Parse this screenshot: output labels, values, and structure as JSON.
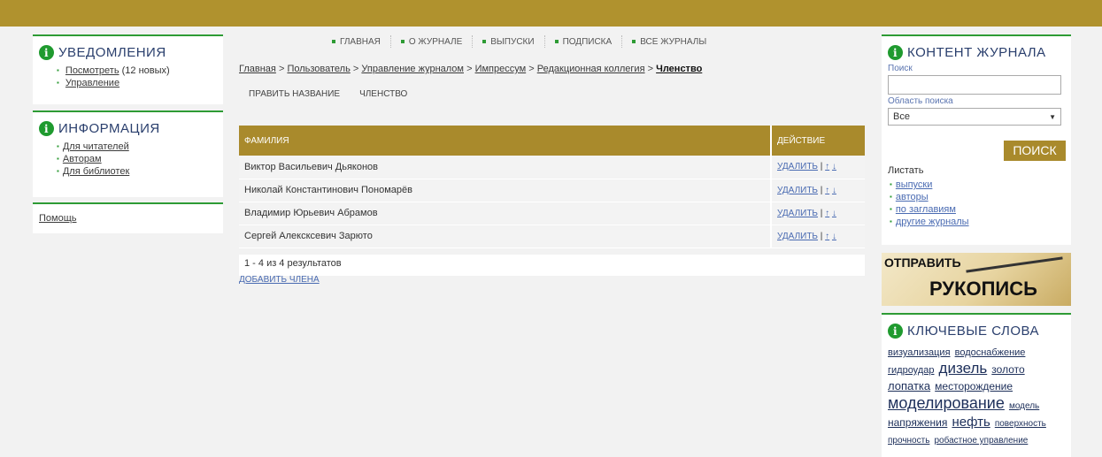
{
  "notifications": {
    "title": "УВЕДОМЛЕНИЯ",
    "view_label": "Посмотреть",
    "view_count": "(12 новых)",
    "manage_label": "Управление"
  },
  "information": {
    "title": "ИНФОРМАЦИЯ",
    "items": [
      "Для читателей",
      "Авторам",
      "Для библиотек"
    ]
  },
  "help": {
    "label": "Помощь"
  },
  "nav": {
    "items": [
      "ГЛАВНАЯ",
      "О ЖУРНАЛЕ",
      "ВЫПУСКИ",
      "ПОДПИСКА",
      "ВСЕ ЖУРНАЛЫ"
    ]
  },
  "breadcrumb": {
    "items": [
      "Главная",
      "Пользователь",
      "Управление журналом",
      "Импрессум",
      "Редакционная коллегия"
    ],
    "current": "Членство",
    "separator": ">"
  },
  "subtabs": [
    "ПРАВИТЬ НАЗВАНИЕ",
    "ЧЛЕНСТВО"
  ],
  "table": {
    "col_name": "ФАМИЛИЯ",
    "col_action": "ДЕЙСТВИЕ",
    "rows": [
      "Виктор Васильевич Дьяконов",
      "Николай Константинович Пономарёв",
      "Владимир Юрьевич Абрамов",
      "Сергей Алексксевич Зарюто"
    ],
    "delete_label": "УДАЛИТЬ",
    "action_sep": "|",
    "up_arrow": "↑",
    "down_arrow": "↓",
    "results": "1 - 4 из 4 результатов",
    "add_label": "ДОБАВИТЬ ЧЛЕНА"
  },
  "journal_content": {
    "title": "КОНТЕНТ ЖУРНАЛА",
    "search_label": "Поиск",
    "search_value": "",
    "scope_label": "Область поиска",
    "scope_value": "Все",
    "search_button": "ПОИСК",
    "browse_title": "Листать",
    "browse_items": [
      "выпуски",
      "авторы",
      "по заглавиям",
      "другие журналы"
    ]
  },
  "banner": {
    "line1": "ОТПРАВИТЬ",
    "line2": "РУКОПИСЬ"
  },
  "keywords": {
    "title": "КЛЮЧЕВЫЕ СЛОВА",
    "tags": [
      {
        "text": "визуализация",
        "size": 11
      },
      {
        "text": "водоснабжение",
        "size": 11
      },
      {
        "text": "гидроудар",
        "size": 11
      },
      {
        "text": "дизель",
        "size": 17
      },
      {
        "text": "золото",
        "size": 12
      },
      {
        "text": "лопатка",
        "size": 13
      },
      {
        "text": "месторождение",
        "size": 12
      },
      {
        "text": "моделирование",
        "size": 18
      },
      {
        "text": "модель",
        "size": 10
      },
      {
        "text": "напряжения",
        "size": 12
      },
      {
        "text": "нефть",
        "size": 15
      },
      {
        "text": "поверхность",
        "size": 10
      },
      {
        "text": "прочность",
        "size": 10
      },
      {
        "text": "робастное управление",
        "size": 10
      }
    ]
  },
  "colors": {
    "accent_gold": "#b0922e",
    "accent_green": "#2e9b35",
    "title_blue": "#2a3f6d"
  }
}
